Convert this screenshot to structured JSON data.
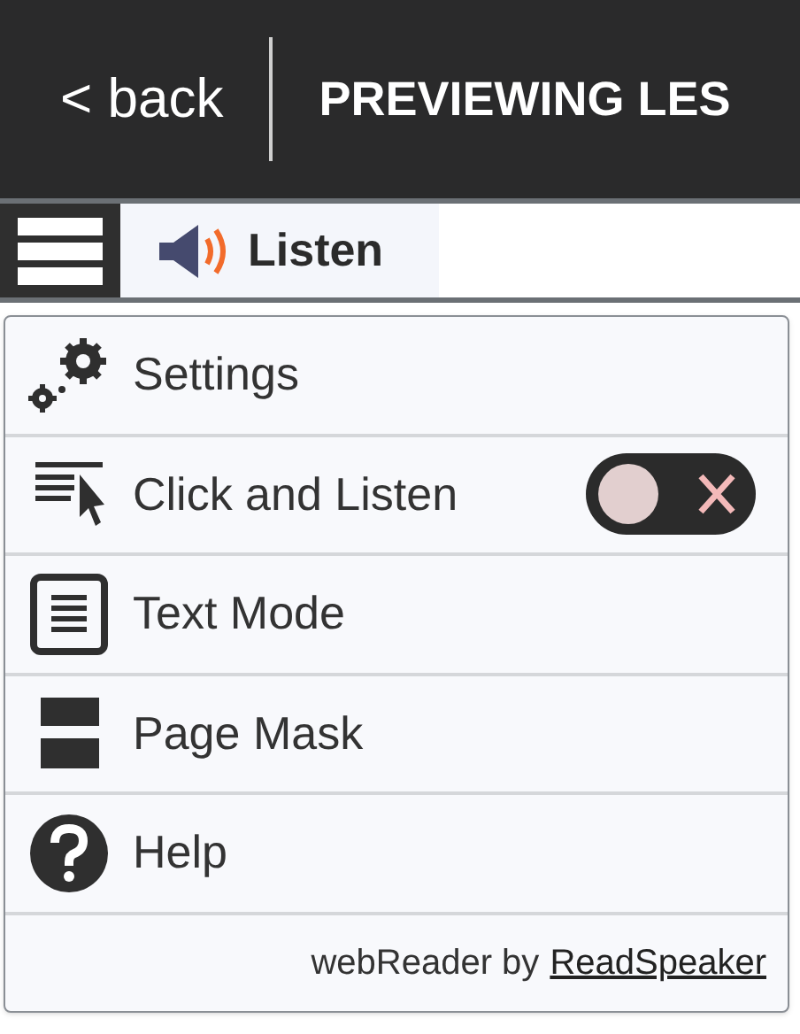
{
  "header": {
    "back": "< back",
    "title": "PREVIEWING LES"
  },
  "toolbar": {
    "listen": "Listen"
  },
  "menu": {
    "items": [
      {
        "kind": "settings",
        "label": "Settings"
      },
      {
        "kind": "toggle",
        "label": "Click and Listen",
        "on": false
      },
      {
        "kind": "textmode",
        "label": "Text Mode"
      },
      {
        "kind": "pagemask",
        "label": "Page Mask"
      },
      {
        "kind": "help",
        "label": "Help"
      }
    ],
    "footer": {
      "text": "webReader by",
      "link": "ReadSpeaker"
    }
  }
}
